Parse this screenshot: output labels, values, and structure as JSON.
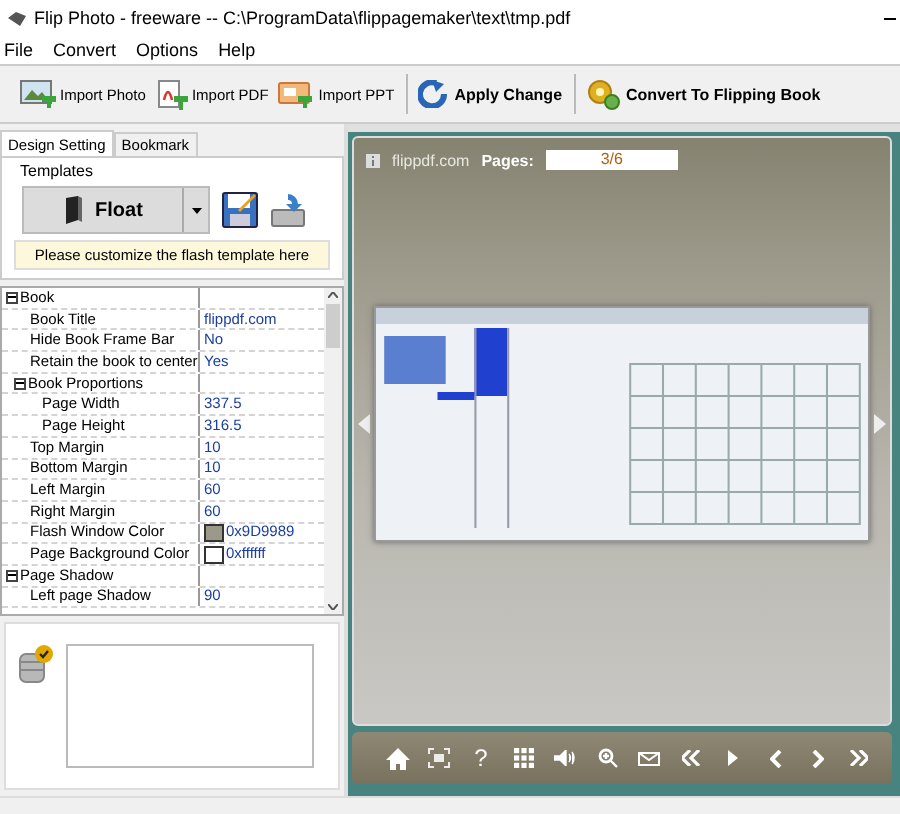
{
  "window": {
    "title": "Flip Photo - freeware -- C:\\ProgramData\\flippagemaker\\text\\tmp.pdf"
  },
  "menu": [
    "File",
    "Convert",
    "Options",
    "Help"
  ],
  "toolbar": [
    {
      "kind": "photo",
      "label": "Import Photo",
      "bold": false
    },
    {
      "kind": "pdf",
      "label": "Import PDF",
      "bold": false
    },
    {
      "kind": "ppt",
      "label": "Import PPT",
      "bold": false
    },
    {
      "kind": "apply",
      "label": "Apply Change",
      "bold": true
    },
    {
      "kind": "convert",
      "label": "Convert To Flipping Book",
      "bold": true
    }
  ],
  "tabs": [
    {
      "label": "Design Setting",
      "selected": true
    },
    {
      "label": "Bookmark",
      "selected": false
    }
  ],
  "templates": {
    "label": "Templates",
    "value": "Float",
    "hint": "Please customize the flash template here"
  },
  "properties": [
    {
      "name": "Book",
      "expanded": true,
      "children": [
        {
          "name": "Book Title",
          "value": "flippdf.com"
        },
        {
          "name": "Hide Book Frame Bar",
          "value": "No"
        },
        {
          "name": "Retain the book to center",
          "value": "Yes"
        },
        {
          "name": "Book Proportions",
          "expanded": true,
          "children": [
            {
              "name": "Page Width",
              "value": "337.5"
            },
            {
              "name": "Page Height",
              "value": "316.5"
            }
          ]
        },
        {
          "name": "Top Margin",
          "value": "10"
        },
        {
          "name": "Bottom Margin",
          "value": "10"
        },
        {
          "name": "Left Margin",
          "value": "60"
        },
        {
          "name": "Right Margin",
          "value": "60"
        },
        {
          "name": "Flash Window Color",
          "value": "0x9D9989",
          "color": "#9d9989"
        },
        {
          "name": "Page Background Color",
          "value": "0xffffff",
          "color": "#ffffff"
        }
      ]
    },
    {
      "name": "Page Shadow",
      "expanded": true,
      "children": [
        {
          "name": "Left page Shadow",
          "value": "90"
        }
      ]
    }
  ],
  "preview": {
    "site": "flippdf.com",
    "pages_label": "Pages:",
    "page_value": "3/6",
    "nav": [
      {
        "kind": "home"
      },
      {
        "kind": "fit"
      },
      {
        "kind": "help",
        "label": "?"
      },
      {
        "kind": "grid"
      },
      {
        "kind": "sound"
      },
      {
        "kind": "zoom"
      },
      {
        "kind": "mail"
      },
      {
        "kind": "first"
      },
      {
        "kind": "play"
      },
      {
        "kind": "prev"
      },
      {
        "kind": "next"
      },
      {
        "kind": "last"
      }
    ]
  }
}
